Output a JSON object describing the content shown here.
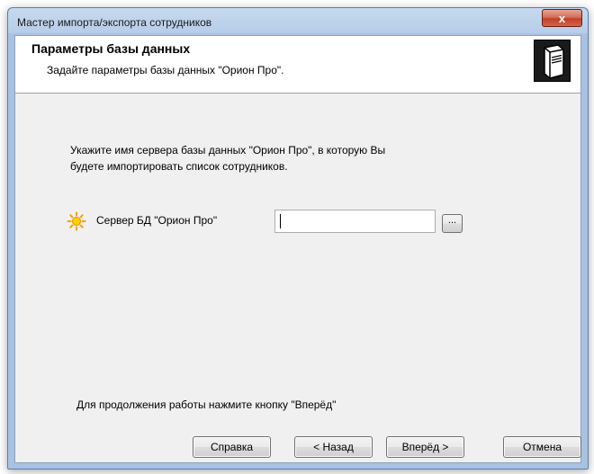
{
  "window": {
    "title": "Мастер импорта/экспорта сотрудников",
    "close_label": "x"
  },
  "header": {
    "title": "Параметры базы данных",
    "subtitle": "Задайте параметры базы данных \"Орион Про\".",
    "icon": "server-icon"
  },
  "main": {
    "instruction_line1": "Укажите имя сервера базы данных \"Орион Про\", в которую Вы",
    "instruction_line2": "будете импортировать список сотрудников.",
    "server_field": {
      "icon": "sun-icon",
      "label": "Сервер БД \"Орион Про\"",
      "value": "",
      "browse_label": "..."
    },
    "hint": "Для продолжения работы нажмите кнопку \"Вперёд\""
  },
  "buttons": {
    "help": "Справка",
    "back": "< Назад",
    "next": "Вперёд >",
    "cancel": "Отмена"
  }
}
